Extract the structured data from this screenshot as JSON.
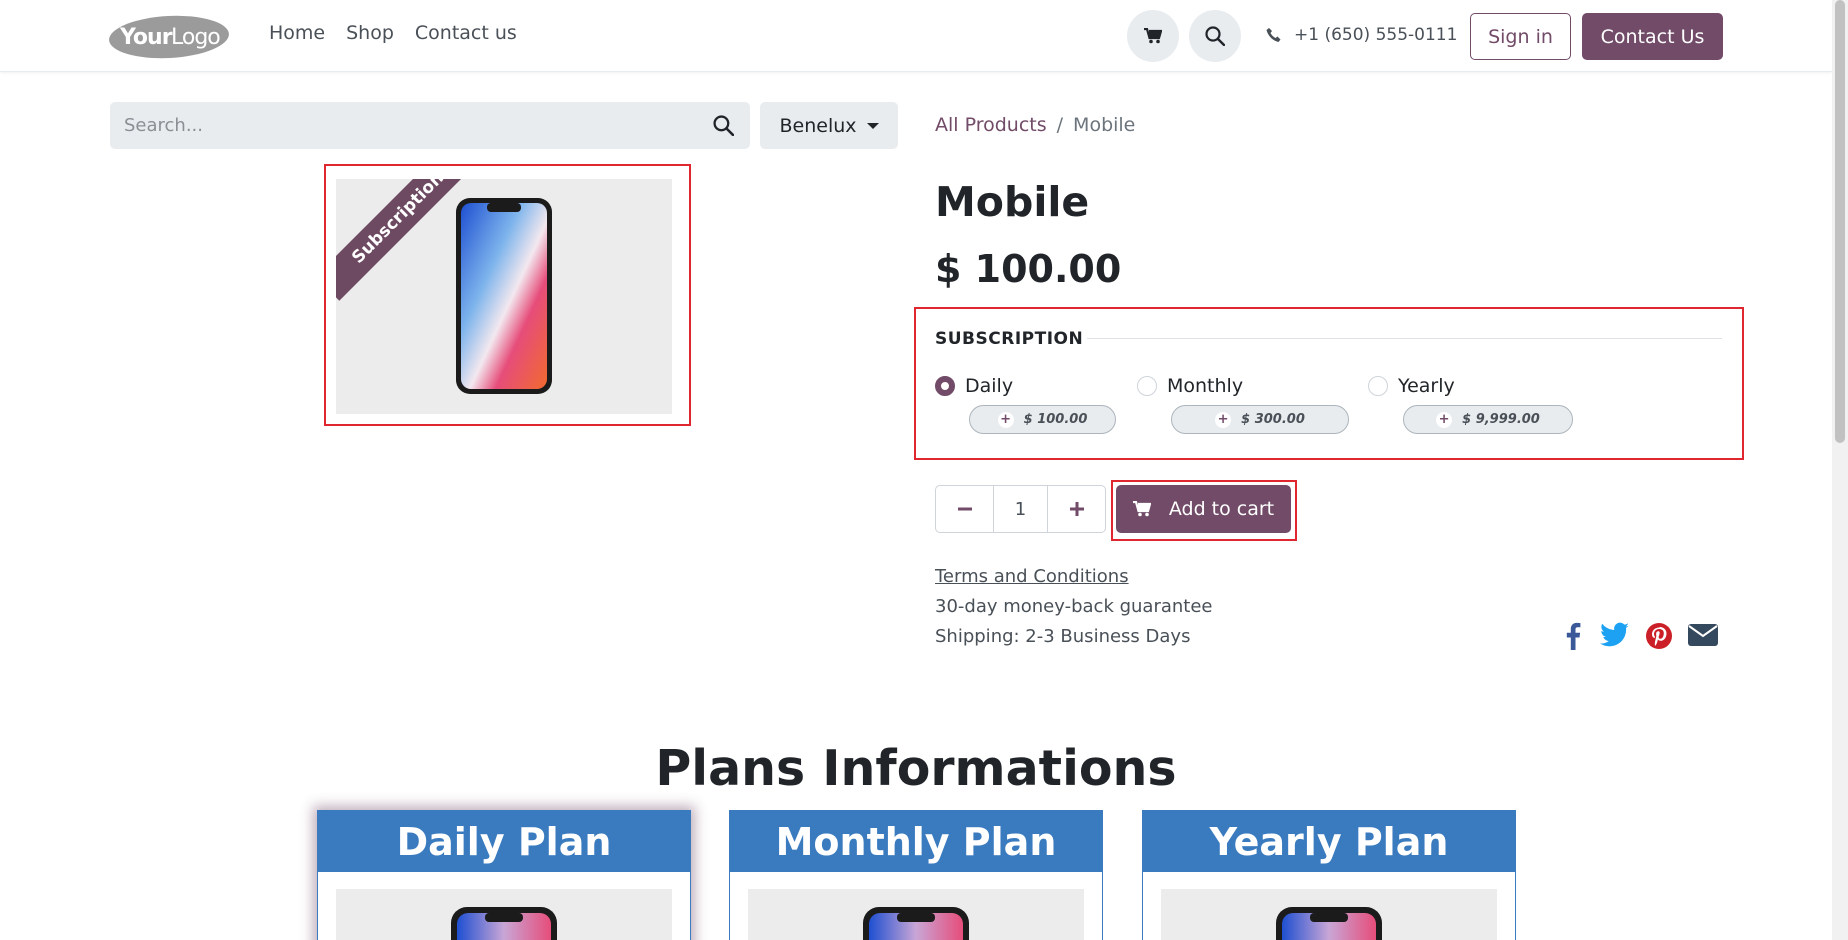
{
  "header": {
    "logo_text": "YourLogo",
    "nav": [
      "Home",
      "Shop",
      "Contact us"
    ],
    "phone": "+1 (650) 555-0111",
    "sign_in": "Sign in",
    "contact_us": "Contact Us"
  },
  "search": {
    "placeholder": "Search..."
  },
  "pricelist": {
    "selected": "Benelux"
  },
  "breadcrumb": {
    "parent": "All Products",
    "separator": "/",
    "current": "Mobile"
  },
  "product": {
    "ribbon": "Subscription",
    "title": "Mobile",
    "price": "$ 100.00",
    "quantity": "1",
    "add_to_cart": "Add to cart",
    "terms": "Terms and Conditions",
    "guarantee": "30-day money-back guarantee",
    "shipping": "Shipping: 2-3 Business Days"
  },
  "subscription": {
    "title": "SUBSCRIPTION",
    "options": [
      {
        "label": "Daily",
        "price": "$ 100.00",
        "selected": true
      },
      {
        "label": "Monthly",
        "price": "$ 300.00",
        "selected": false
      },
      {
        "label": "Yearly",
        "price": "$ 9,999.00",
        "selected": false
      }
    ]
  },
  "social": [
    "facebook-icon",
    "twitter-icon",
    "pinterest-icon",
    "envelope-icon"
  ],
  "plans": {
    "title": "Plans Informations",
    "cards": [
      "Daily Plan",
      "Monthly Plan",
      "Yearly Plan"
    ]
  },
  "colors": {
    "primary": "#714b67",
    "plan_header": "#3a7bbf",
    "highlight": "#e0262f",
    "facebook": "#3b5998",
    "twitter": "#1da1f2",
    "pinterest": "#cb2027"
  }
}
